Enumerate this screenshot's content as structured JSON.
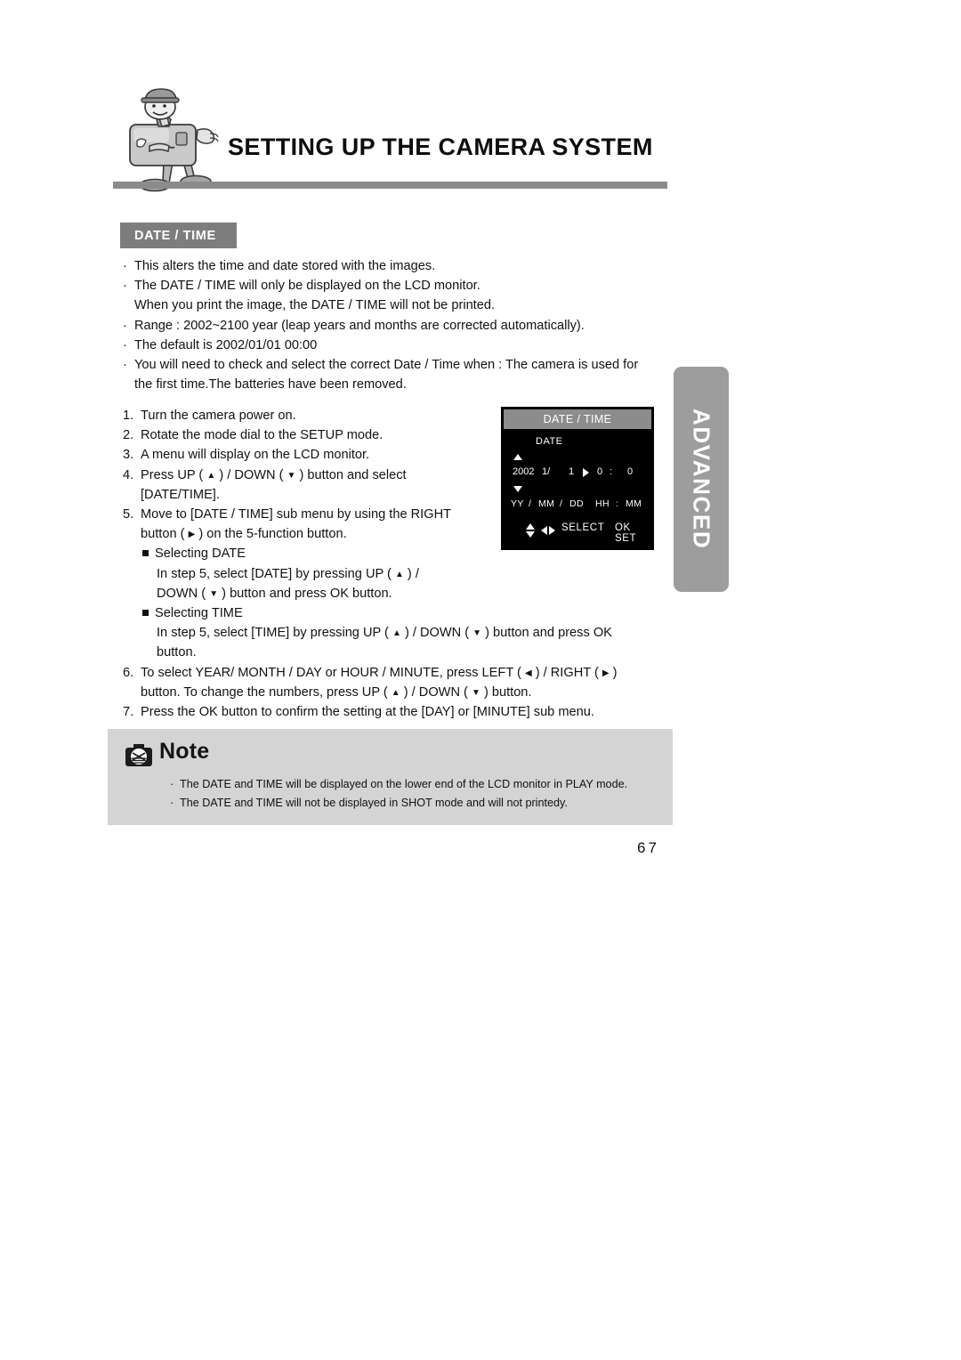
{
  "header": {
    "title": "SETTING UP THE CAMERA SYSTEM",
    "mascot_icon": "camera-mascot-illustration"
  },
  "section": {
    "badge_label": "DATE / TIME"
  },
  "bullets": [
    {
      "marker": "·",
      "text": "This alters the time and date stored with the images."
    },
    {
      "marker": "·",
      "text": "The DATE / TIME will only be displayed on the LCD monitor."
    },
    {
      "marker": "",
      "text": "When you print the image, the DATE / TIME will not be printed."
    },
    {
      "marker": "·",
      "text": "Range : 2002~2100 year (leap years and months are corrected automatically)."
    },
    {
      "marker": "·",
      "text": "The default is 2002/01/01 00:00"
    },
    {
      "marker": "·",
      "text": "You will need to check and select the correct Date / Time when : The camera is used for"
    },
    {
      "marker": "",
      "text": "the first time.The batteries have been removed."
    }
  ],
  "steps": {
    "s1_num": "1.",
    "s1_text": "Turn the camera power on.",
    "s2_num": "2.",
    "s2_text": "Rotate the mode dial to the SETUP mode.",
    "s3_num": "3.",
    "s3_text": "A menu will display on the LCD monitor.",
    "s4_num": "4.",
    "s4_a": "Press UP (",
    "s4_b": ") / DOWN (",
    "s4_c": ") button and select",
    "s4_cont": "[DATE/TIME].",
    "s5_num": "5.",
    "s5_text": "Move to [DATE / TIME] sub menu by using the RIGHT",
    "s5_a": "button (",
    "s5_b": ") on the 5-function button.",
    "sel_date_label": "Selecting DATE",
    "sel_date_l1a": "In step 5, select [DATE] by pressing UP (",
    "sel_date_l1b": ") /",
    "sel_date_l2a": "DOWN (",
    "sel_date_l2b": ") button and press OK button.",
    "sel_time_label": "Selecting TIME",
    "sel_time_l1a": "In step 5, select [TIME] by pressing UP (",
    "sel_time_l1b": ") / DOWN (",
    "sel_time_l1c": ") button and press OK",
    "sel_time_l2": "button.",
    "s6_num": "6.",
    "s6_a": "To select YEAR/ MONTH / DAY or HOUR / MINUTE, press LEFT (",
    "s6_b": ") / RIGHT (",
    "s6_c": ")",
    "s6_d": "button. To change the numbers, press UP (",
    "s6_e": ") / DOWN (",
    "s6_f": ") button.",
    "s7_num": "7.",
    "s7_text": "Press the OK button to confirm the setting at the [DAY] or [MINUTE] sub menu."
  },
  "side_tab": {
    "label": "ADVANCED",
    "color": "#9d9d9d"
  },
  "lcd": {
    "title": "DATE / TIME",
    "submenu": "DATE",
    "up_arrow_icon": "triangle-up-icon",
    "down_arrow_icon": "triangle-down-icon",
    "year": "2002",
    "month": "1/",
    "day": "1",
    "caret_icon": "triangle-right-icon",
    "hour": "0",
    "colon": ":",
    "minute": "0",
    "fmt_yy": "YY",
    "fmt_sep1": "/",
    "fmt_mm": "MM",
    "fmt_sep2": "/",
    "fmt_dd": "DD",
    "fmt_hh": "HH",
    "fmt_colon": ":",
    "fmt_min": "MM",
    "footer_select": "SELECT",
    "footer_okset": "OK SET",
    "updown_icon": "updown-arrows-icon",
    "leftright_icon": "leftright-arrows-icon",
    "bg_color": "#000000",
    "title_bar_color": "#8c8c8c"
  },
  "note": {
    "icon": "camera-note-icon",
    "title": "Note",
    "lines": [
      {
        "marker": "·",
        "text": "The DATE and TIME will be displayed on the lower end of the LCD monitor in PLAY mode."
      },
      {
        "marker": "·",
        "text": "The DATE and TIME will not be displayed in SHOT mode and will not printedy."
      }
    ],
    "bg_color": "#d4d4d4"
  },
  "footer": {
    "page_number": "67"
  }
}
